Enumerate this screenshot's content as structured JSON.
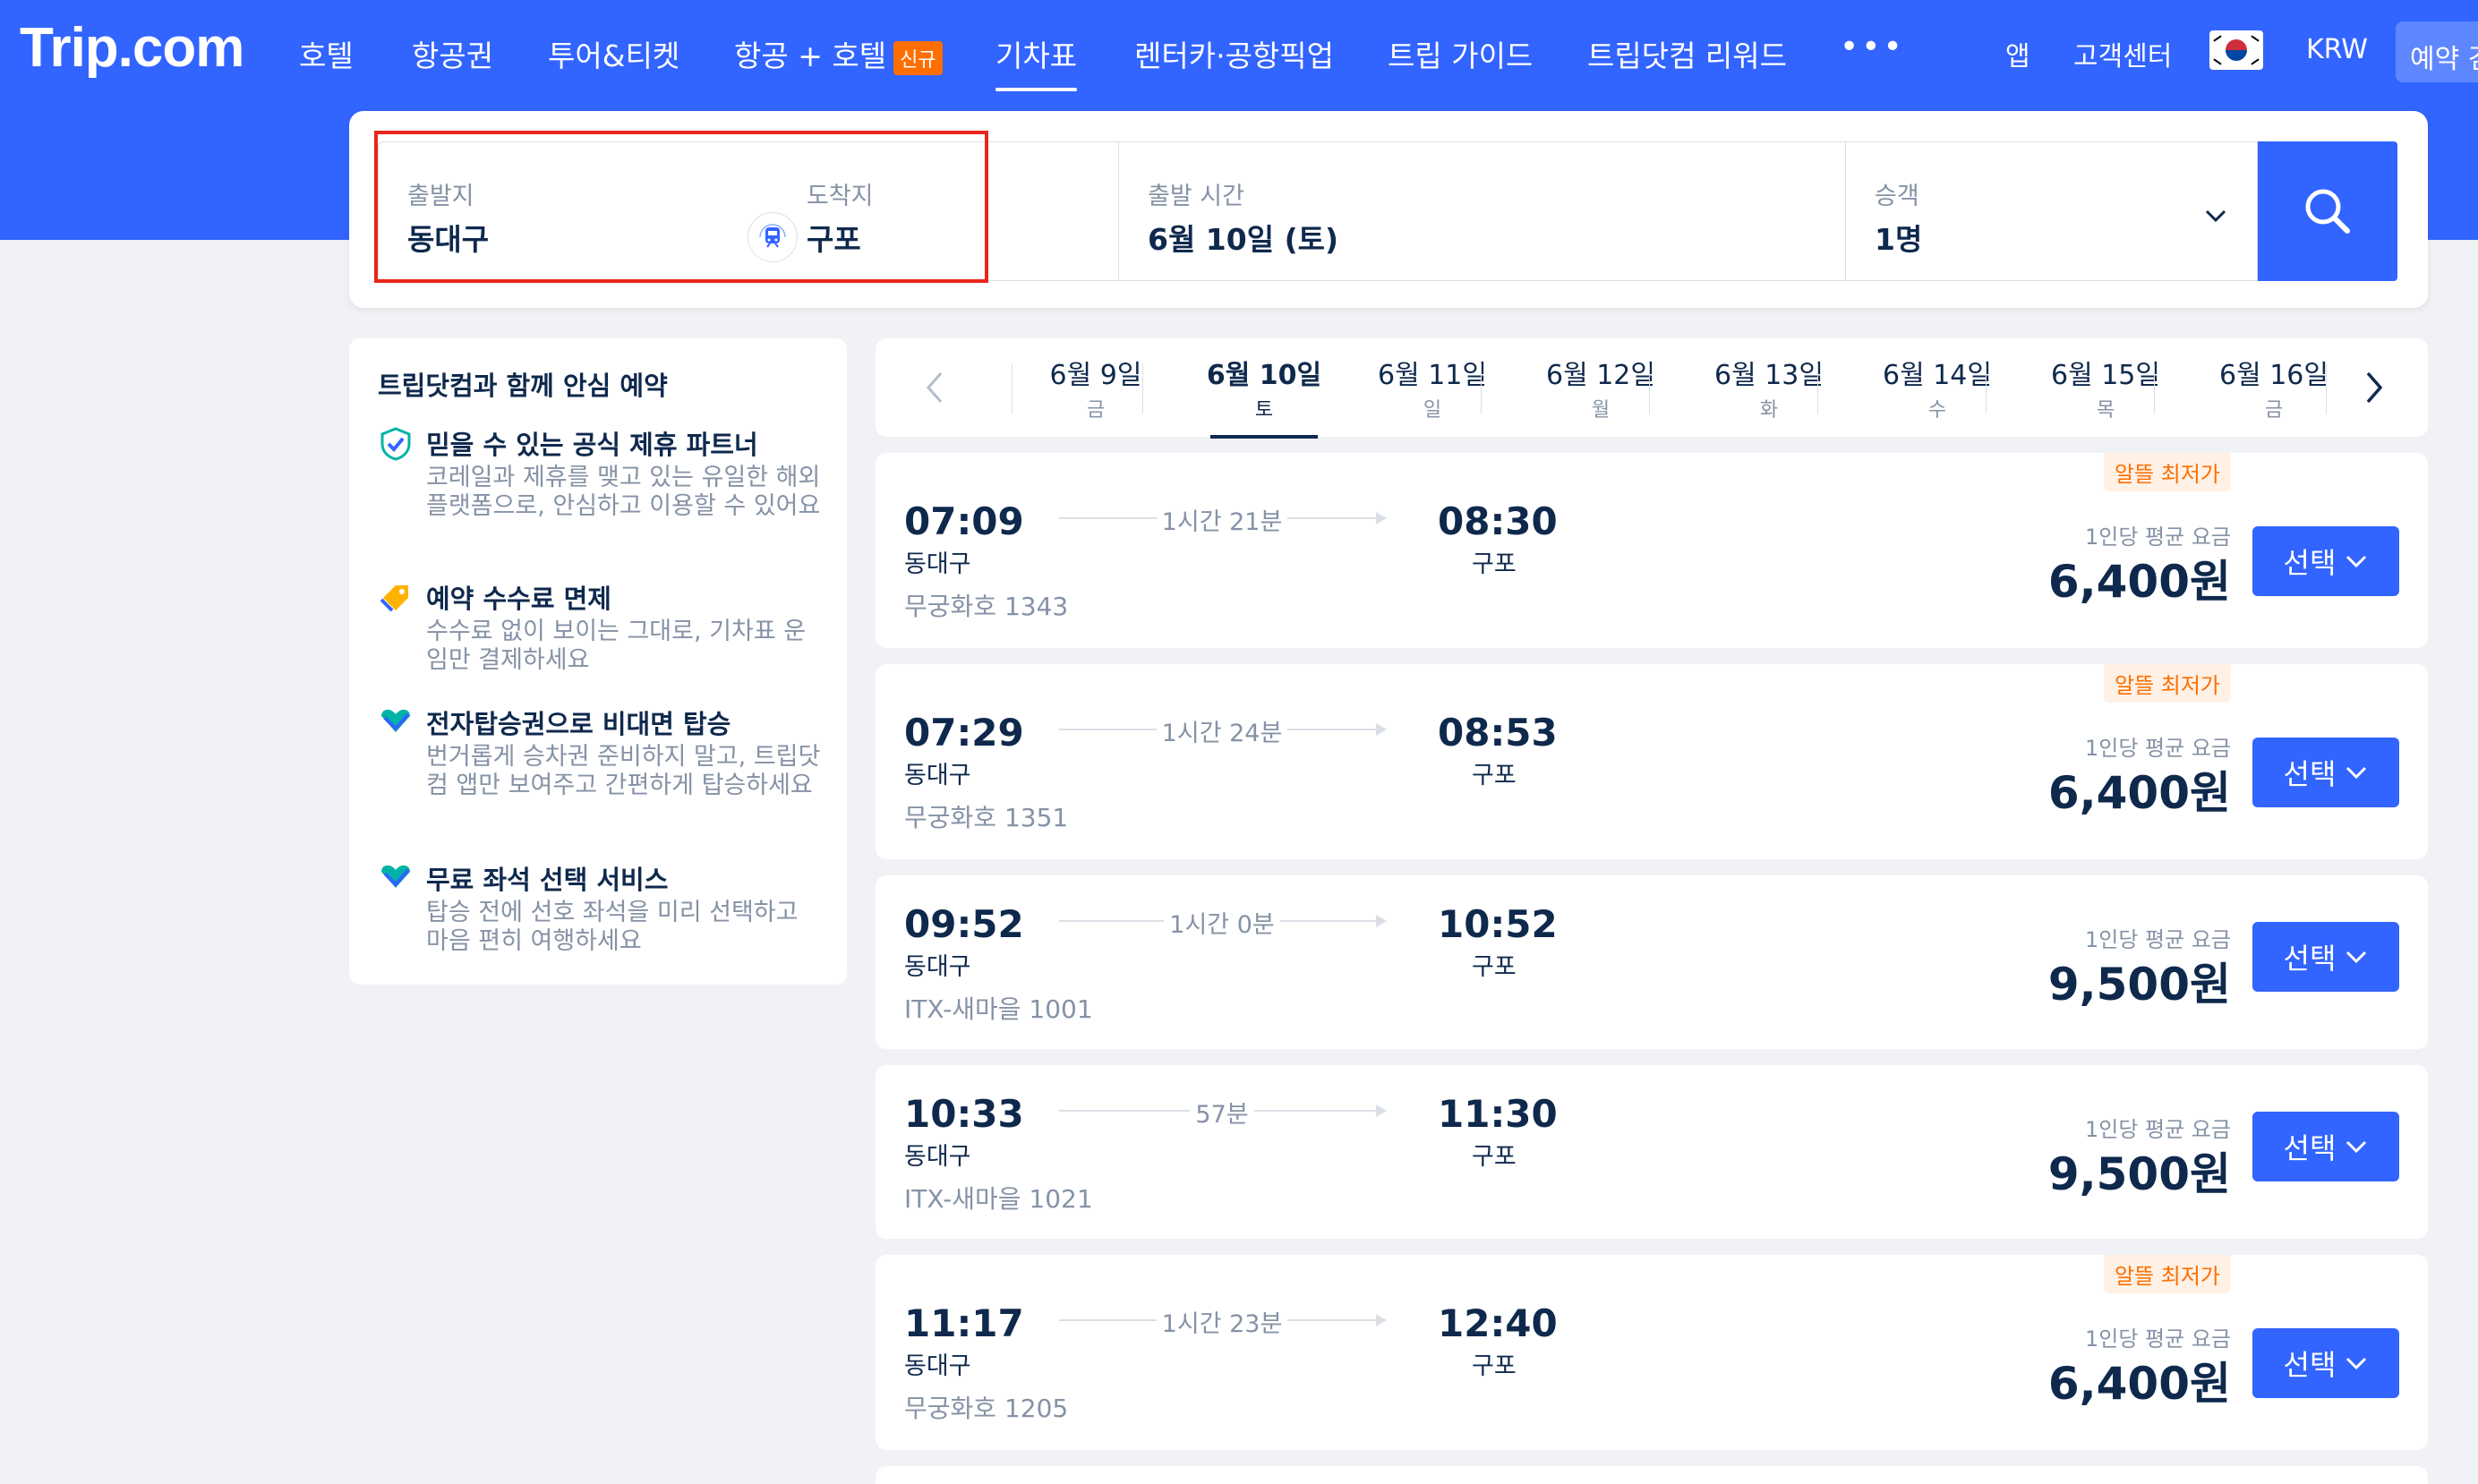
{
  "nav": {
    "logo": "Trip.com",
    "items": [
      "호텔",
      "항공권",
      "투어&티켓",
      "항공 + 호텔",
      "기차표",
      "렌터카·공항픽업",
      "트립 가이드",
      "트립닷컴 리워드"
    ],
    "new_badge": "신규",
    "more": "•••",
    "app": "앱",
    "support": "고객센터",
    "currency": "KRW",
    "reserve": "예약 검색"
  },
  "search": {
    "from_label": "출발지",
    "from_value": "동대구",
    "to_label": "도착지",
    "to_value": "구포",
    "date_label": "출발 시간",
    "date_value": "6월 10일 (토)",
    "pax_label": "승객",
    "pax_value": "1명"
  },
  "sidebar": {
    "title": "트립닷컴과 함께 안심 예약",
    "benefits": [
      {
        "title": "믿을 수 있는 공식 제휴 파트너",
        "desc": "코레일과 제휴를 맺고 있는 유일한 해외 플랫폼으로, 안심하고 이용할 수 있어요"
      },
      {
        "title": "예약 수수료 면제",
        "desc": "수수료 없이 보이는 그대로, 기차표 운임만 결제하세요"
      },
      {
        "title": "전자탑승권으로 비대면 탑승",
        "desc": "번거롭게 승차권 준비하지 말고, 트립닷컴 앱만 보여주고 간편하게 탑승하세요"
      },
      {
        "title": "무료 좌석 선택 서비스",
        "desc": "탑승 전에 선호 좌석을 미리 선택하고 마음 편히 여행하세요"
      }
    ]
  },
  "dates": [
    {
      "date": "6월 9일",
      "day": "금"
    },
    {
      "date": "6월 10일",
      "day": "토"
    },
    {
      "date": "6월 11일",
      "day": "일"
    },
    {
      "date": "6월 12일",
      "day": "월"
    },
    {
      "date": "6월 13일",
      "day": "화"
    },
    {
      "date": "6월 14일",
      "day": "수"
    },
    {
      "date": "6월 15일",
      "day": "목"
    },
    {
      "date": "6월 16일",
      "day": "금"
    }
  ],
  "trains": [
    {
      "tag": "알뜰 최저가",
      "dep": "07:09",
      "dep_st": "동대구",
      "dur": "1시간 21분",
      "arr": "08:30",
      "arr_st": "구포",
      "train": "무궁화호 1343",
      "avg_label": "1인당 평균 요금",
      "price": "6,400원",
      "select": "선택"
    },
    {
      "tag": "알뜰 최저가",
      "dep": "07:29",
      "dep_st": "동대구",
      "dur": "1시간 24분",
      "arr": "08:53",
      "arr_st": "구포",
      "train": "무궁화호 1351",
      "avg_label": "1인당 평균 요금",
      "price": "6,400원",
      "select": "선택"
    },
    {
      "tag": "",
      "dep": "09:52",
      "dep_st": "동대구",
      "dur": "1시간 0분",
      "arr": "10:52",
      "arr_st": "구포",
      "train": "ITX-새마을 1001",
      "avg_label": "1인당 평균 요금",
      "price": "9,500원",
      "select": "선택"
    },
    {
      "tag": "",
      "dep": "10:33",
      "dep_st": "동대구",
      "dur": "57분",
      "arr": "11:30",
      "arr_st": "구포",
      "train": "ITX-새마을 1021",
      "avg_label": "1인당 평균 요금",
      "price": "9,500원",
      "select": "선택"
    },
    {
      "tag": "알뜰 최저가",
      "dep": "11:17",
      "dep_st": "동대구",
      "dur": "1시간 23분",
      "arr": "12:40",
      "arr_st": "구포",
      "train": "무궁화호 1205",
      "avg_label": "1인당 평균 요금",
      "price": "6,400원",
      "select": "선택"
    }
  ],
  "colors": {
    "brand": "#3264ff",
    "highlight": "#e8261b",
    "tag": "#ff6f00"
  }
}
